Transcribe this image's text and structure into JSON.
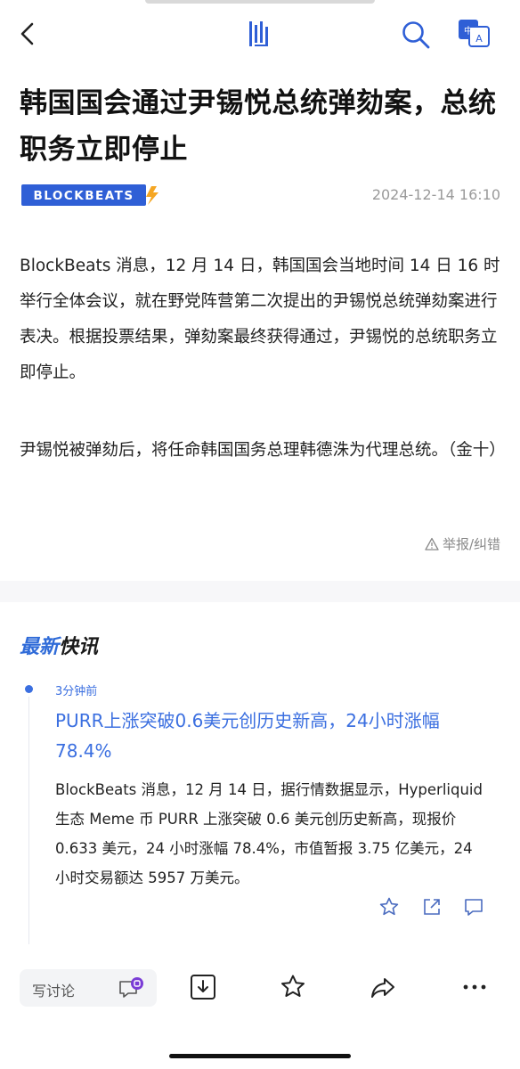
{
  "nav": {
    "back_icon": "chevron-left-icon",
    "logo_icon": "app-logo-icon",
    "search_icon": "search-icon",
    "translate_icon": "translate-icon",
    "translate_glyph_cn": "中",
    "translate_glyph_en": "A"
  },
  "article": {
    "title": "韩国国会通过尹锡悦总统弹劾案，总统职务立即停止",
    "source": "BLOCKBEATS",
    "date": "2024-12-14 16:10",
    "paragraphs": [
      "BlockBeats 消息，12 月 14 日，韩国国会当地时间 14 日 16 时举行全体会议，就在野党阵营第二次提出的尹锡悦总统弹劾案进行表决。根据投票结果，弹劾案最终获得通过，尹锡悦的总统职务立即停止。",
      "尹锡悦被弹劾后，将任命韩国国务总理韩德洙为代理总统。（金十）"
    ],
    "report_label": "举报/纠错"
  },
  "latest": {
    "heading_accent": "最新",
    "heading_rest": "快讯",
    "item": {
      "time": "3分钟前",
      "title": "PURR上涨突破0.6美元创历史新高，24小时涨幅78.4%",
      "body": "BlockBeats 消息，12 月 14 日，据行情数据显示，Hyperliquid 生态 Meme 币 PURR 上涨突破 0.6 美元创历史新高，现报价 0.633 美元，24 小时涨幅 78.4%，市值暂报 3.75 亿美元，24 小时交易额达 5957 万美元。"
    }
  },
  "bottom_bar": {
    "comment_placeholder": "写讨论",
    "icons": [
      "comment-bubble-icon",
      "download-icon",
      "bookmark-star-icon",
      "share-forward-icon",
      "more-icon"
    ]
  },
  "colors": {
    "accent": "#3b6fe0",
    "brand": "#2f5fd6",
    "brand_bolt": "#f5a623"
  }
}
